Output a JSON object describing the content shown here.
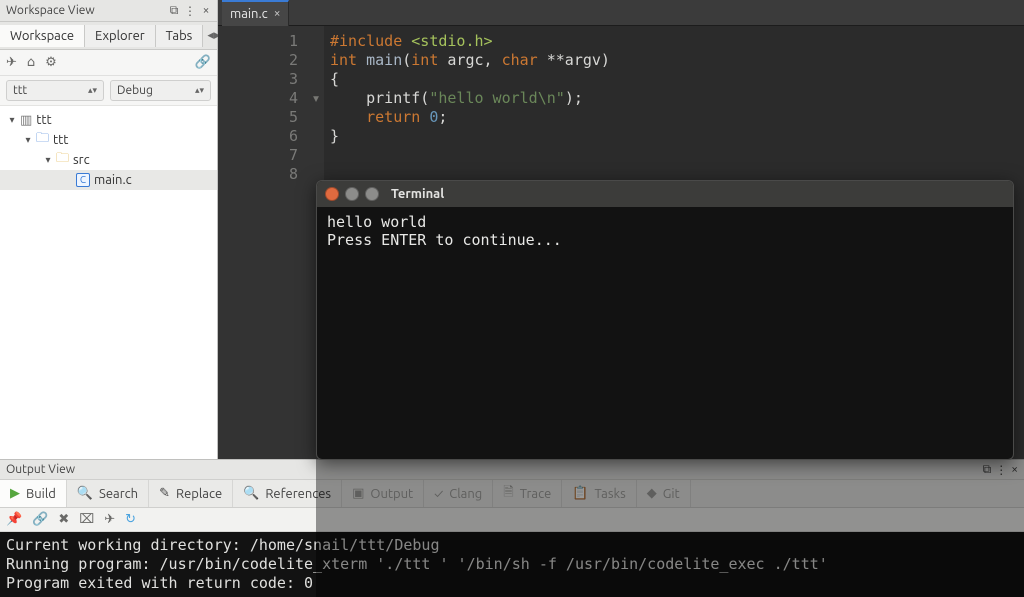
{
  "sidebar": {
    "panel_title": "Workspace View",
    "tabs": [
      "Workspace",
      "Explorer",
      "Tabs"
    ],
    "project_selector": "ttt",
    "config_selector": "Debug",
    "tree": [
      {
        "depth": 0,
        "label": "ttt",
        "expanded": true,
        "icon": "workspace"
      },
      {
        "depth": 1,
        "label": "ttt",
        "expanded": true,
        "icon": "folder-blue"
      },
      {
        "depth": 2,
        "label": "src",
        "expanded": true,
        "icon": "folder-yellow"
      },
      {
        "depth": 3,
        "label": "main.c",
        "expanded": null,
        "icon": "c-file",
        "selected": true
      }
    ]
  },
  "editor": {
    "tab_name": "main.c",
    "line_numbers": [
      "1",
      "2",
      "3",
      "4",
      "5",
      "6",
      "7",
      "8"
    ],
    "fold_marks": [
      "",
      "",
      "",
      "▾",
      "",
      "",
      "",
      ""
    ],
    "code_lines": [
      [
        {
          "c": "tok-pre",
          "t": "#include "
        },
        {
          "c": "tok-inc",
          "t": "<stdio.h>"
        }
      ],
      [
        {
          "c": "",
          "t": ""
        }
      ],
      [
        {
          "c": "tok-type",
          "t": "int "
        },
        {
          "c": "tok-fn",
          "t": "main"
        },
        {
          "c": "",
          "t": "("
        },
        {
          "c": "tok-type",
          "t": "int "
        },
        {
          "c": "",
          "t": "argc, "
        },
        {
          "c": "tok-type",
          "t": "char "
        },
        {
          "c": "",
          "t": "**argv)"
        }
      ],
      [
        {
          "c": "",
          "t": "{"
        }
      ],
      [
        {
          "c": "",
          "t": "    printf("
        },
        {
          "c": "tok-str",
          "t": "\"hello world\\n\""
        },
        {
          "c": "",
          "t": ");"
        }
      ],
      [
        {
          "c": "",
          "t": "    "
        },
        {
          "c": "tok-kw",
          "t": "return "
        },
        {
          "c": "tok-num",
          "t": "0"
        },
        {
          "c": "",
          "t": ";"
        }
      ],
      [
        {
          "c": "",
          "t": "}"
        }
      ],
      [
        {
          "c": "",
          "t": ""
        }
      ]
    ]
  },
  "terminal": {
    "title": "Terminal",
    "lines": "hello world\nPress ENTER to continue..."
  },
  "output_view": {
    "panel_title": "Output View",
    "tabs": [
      {
        "label": "Build",
        "icon": "play-green"
      },
      {
        "label": "Search",
        "icon": "magnifier"
      },
      {
        "label": "Replace",
        "icon": "pencil"
      },
      {
        "label": "References",
        "icon": "magnifier"
      },
      {
        "label": "Output",
        "icon": "terminal-dim"
      },
      {
        "label": "Clang",
        "icon": "check-dim"
      },
      {
        "label": "Trace",
        "icon": "page-dim"
      },
      {
        "label": "Tasks",
        "icon": "clipboard-dim"
      },
      {
        "label": "Git",
        "icon": "git-dim"
      }
    ],
    "text": "Current working directory: /home/snail/ttt/Debug\nRunning program: /usr/bin/codelite_xterm './ttt ' '/bin/sh -f /usr/bin/codelite_exec ./ttt'\nProgram exited with return code: 0"
  }
}
